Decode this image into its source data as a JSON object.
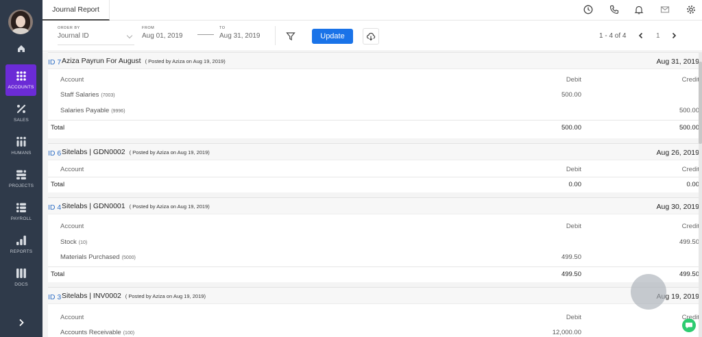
{
  "app": {
    "tab_title": "Journal Report"
  },
  "sidebar": {
    "items": [
      {
        "label": "ACCOUNTS",
        "icon": "grid-icon",
        "active": true
      },
      {
        "label": "SALES",
        "icon": "percent-icon"
      },
      {
        "label": "HUMANS",
        "icon": "people-icon"
      },
      {
        "label": "PROJECTS",
        "icon": "projects-icon"
      },
      {
        "label": "PAYROLL",
        "icon": "payroll-icon"
      },
      {
        "label": "REPORTS",
        "icon": "bar-chart-icon"
      },
      {
        "label": "DOCS",
        "icon": "docs-icon"
      }
    ],
    "accent_color": "#6b2bd6",
    "bg_color": "#2f3a4a"
  },
  "filters": {
    "order_by": {
      "caption": "ORDER BY",
      "value": "Journal ID"
    },
    "from": {
      "caption": "FROM",
      "value": "Aug 01, 2019"
    },
    "to": {
      "caption": "TO",
      "value": "Aug 31, 2019"
    },
    "update_label": "Update"
  },
  "pagination": {
    "range": "1 - 4 of 4",
    "page": "1"
  },
  "columns": {
    "account": "Account",
    "debit": "Debit",
    "credit": "Credit",
    "total": "Total"
  },
  "entries": [
    {
      "id": "ID 7",
      "title": "Aziza Payrun For August",
      "posted": "( Posted by Aziza on Aug 19, 2019)",
      "date": "Aug 31, 2019",
      "lines": [
        {
          "account": "Staff Salaries",
          "code": "(7003)",
          "debit": "500.00",
          "credit": ""
        },
        {
          "account": "Salaries Payable",
          "code": "(9996)",
          "debit": "",
          "credit": "500.00"
        }
      ],
      "total_debit": "500.00",
      "total_credit": "500.00"
    },
    {
      "id": "ID 6",
      "title": "Sitelabs | GDN0002",
      "posted": "( Posted by Aziza on Aug 19, 2019)",
      "date": "Aug 26, 2019",
      "lines": [],
      "total_debit": "0.00",
      "total_credit": "0.00"
    },
    {
      "id": "ID 4",
      "title": "Sitelabs | GDN0001",
      "posted": "( Posted by Aziza on Aug 19, 2019)",
      "date": "Aug 30, 2019",
      "lines": [
        {
          "account": "Stock",
          "code": "(10)",
          "debit": "",
          "credit": "499.50"
        },
        {
          "account": "Materials Purchased",
          "code": "(5000)",
          "debit": "499.50",
          "credit": ""
        }
      ],
      "total_debit": "499.50",
      "total_credit": "499.50"
    },
    {
      "id": "ID 3",
      "title": "Sitelabs | INV0002",
      "posted": "( Posted by Aziza on Aug 19, 2019)",
      "date": "Aug 19, 2019",
      "lines": [
        {
          "account": "Accounts Receivable",
          "code": "(100)",
          "debit": "12,000.00",
          "credit": ""
        }
      ],
      "total_debit": "",
      "total_credit": ""
    }
  ],
  "colors": {
    "primary_button": "#1a73e8",
    "id_link": "#2b6cc4",
    "chat": "#2ecc71"
  }
}
